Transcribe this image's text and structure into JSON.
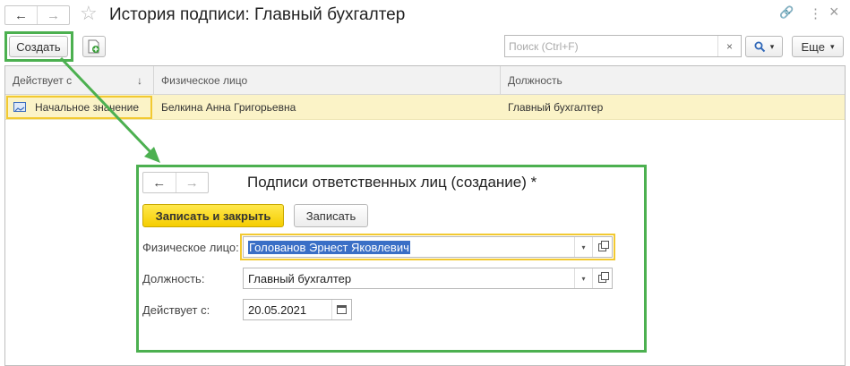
{
  "window": {
    "title": "История подписи: Главный бухгалтер",
    "back_glyph": "←",
    "forward_glyph": "→",
    "star_glyph": "☆",
    "link_glyph": "🔗",
    "menu_glyph": "⋮",
    "close_glyph": "×"
  },
  "toolbar": {
    "create_label": "Создать",
    "search_placeholder": "Поиск (Ctrl+F)",
    "clear_glyph": "×",
    "search_glyph": "🔍",
    "search_dropdown_glyph": "▾",
    "more_label": "Еще",
    "more_dropdown_glyph": "▾"
  },
  "table": {
    "columns": [
      {
        "label": "Действует с",
        "sort_glyph": "↓"
      },
      {
        "label": "Физическое лицо"
      },
      {
        "label": "Должность"
      }
    ],
    "rows": [
      {
        "effective": "Начальное значение",
        "person": "Белкина Анна Григорьевна",
        "position": "Главный бухгалтер"
      }
    ]
  },
  "dialog": {
    "title": "Подписи ответственных лиц (создание) *",
    "back_glyph": "←",
    "forward_glyph": "→",
    "save_close_label": "Записать и закрыть",
    "save_label": "Записать",
    "fields": {
      "person": {
        "label": "Физическое лицо:",
        "value": "Голованов Эрнест Яковлевич"
      },
      "position": {
        "label": "Должность:",
        "value": "Главный бухгалтер"
      },
      "date": {
        "label": "Действует с:",
        "value": "20.05.2021"
      }
    },
    "dropdown_glyph": "▾"
  },
  "colors": {
    "highlight_green": "#4cb050",
    "selected_row": "#fbf3c7",
    "focus_yellow": "#f2c931",
    "primary_button": "#f5cd00"
  }
}
